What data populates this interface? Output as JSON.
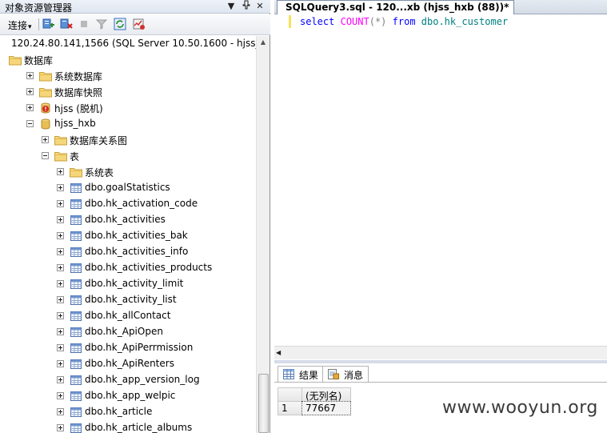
{
  "object_explorer": {
    "title": "对象资源管理器",
    "title_buttons": [
      "▼",
      "ᵖ",
      "✕"
    ],
    "toolbar": {
      "connect_label": "连接",
      "connect_arrow": "▾"
    },
    "server_node": "120.24.80.141,1566 (SQL Server 10.50.1600 - hjss_hxb",
    "tree": [
      {
        "label": "数据库",
        "indent": 0,
        "expander": "none",
        "icon": "folder-icon"
      },
      {
        "label": "系统数据库",
        "indent": 1,
        "expander": "plus",
        "icon": "folder-icon"
      },
      {
        "label": "数据库快照",
        "indent": 1,
        "expander": "plus",
        "icon": "folder-icon"
      },
      {
        "label": "hjss (脱机)",
        "indent": 1,
        "expander": "plus",
        "icon": "database-offline-icon"
      },
      {
        "label": "hjss_hxb",
        "indent": 1,
        "expander": "minus",
        "icon": "database-icon"
      },
      {
        "label": "数据库关系图",
        "indent": 2,
        "expander": "plus",
        "icon": "folder-icon"
      },
      {
        "label": "表",
        "indent": 2,
        "expander": "minus",
        "icon": "folder-icon"
      },
      {
        "label": "系统表",
        "indent": 3,
        "expander": "plus",
        "icon": "folder-icon"
      },
      {
        "label": "dbo.goalStatistics",
        "indent": 3,
        "expander": "plus",
        "icon": "table-icon"
      },
      {
        "label": "dbo.hk_activation_code",
        "indent": 3,
        "expander": "plus",
        "icon": "table-icon"
      },
      {
        "label": "dbo.hk_activities",
        "indent": 3,
        "expander": "plus",
        "icon": "table-icon"
      },
      {
        "label": "dbo.hk_activities_bak",
        "indent": 3,
        "expander": "plus",
        "icon": "table-icon"
      },
      {
        "label": "dbo.hk_activities_info",
        "indent": 3,
        "expander": "plus",
        "icon": "table-icon"
      },
      {
        "label": "dbo.hk_activities_products",
        "indent": 3,
        "expander": "plus",
        "icon": "table-icon"
      },
      {
        "label": "dbo.hk_activity_limit",
        "indent": 3,
        "expander": "plus",
        "icon": "table-icon"
      },
      {
        "label": "dbo.hk_activity_list",
        "indent": 3,
        "expander": "plus",
        "icon": "table-icon"
      },
      {
        "label": "dbo.hk_allContact",
        "indent": 3,
        "expander": "plus",
        "icon": "table-icon"
      },
      {
        "label": "dbo.hk_ApiOpen",
        "indent": 3,
        "expander": "plus",
        "icon": "table-icon"
      },
      {
        "label": "dbo.hk_ApiPerrmission",
        "indent": 3,
        "expander": "plus",
        "icon": "table-icon"
      },
      {
        "label": "dbo.hk_ApiRenters",
        "indent": 3,
        "expander": "plus",
        "icon": "table-icon"
      },
      {
        "label": "dbo.hk_app_version_log",
        "indent": 3,
        "expander": "plus",
        "icon": "table-icon"
      },
      {
        "label": "dbo.hk_app_welpic",
        "indent": 3,
        "expander": "plus",
        "icon": "table-icon"
      },
      {
        "label": "dbo.hk_article",
        "indent": 3,
        "expander": "plus",
        "icon": "table-icon"
      },
      {
        "label": "dbo.hk_article_albums",
        "indent": 3,
        "expander": "plus",
        "icon": "table-icon"
      }
    ]
  },
  "editor": {
    "tab_title": "SQLQuery3.sql - 120...xb (hjss_hxb (88))*",
    "code": {
      "kw1": "select",
      "fn": "COUNT",
      "paren": "(*)",
      "kw2": "from",
      "obj": "dbo.hk_customer"
    }
  },
  "results": {
    "tabs": [
      {
        "label": "结果",
        "icon": "grid-icon"
      },
      {
        "label": "消息",
        "icon": "message-icon"
      }
    ],
    "column_header": "(无列名)",
    "row_number": "1",
    "value": "77667"
  },
  "watermark": "www.wooyun.org"
}
